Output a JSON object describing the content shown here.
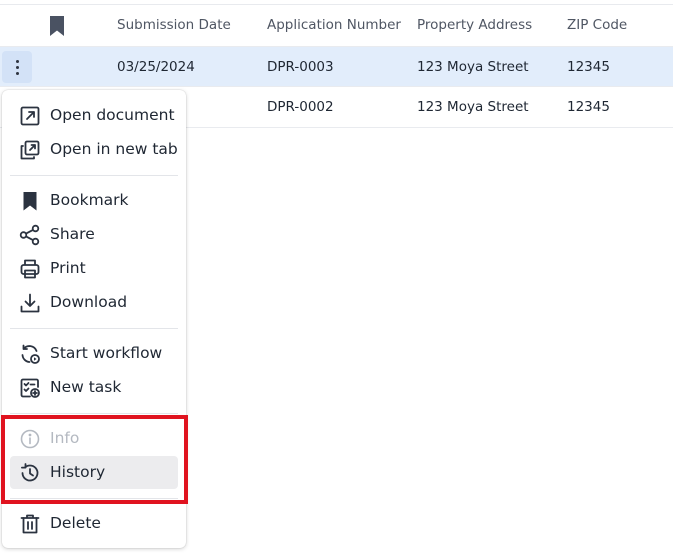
{
  "table": {
    "columns": {
      "submission_date": "Submission Date",
      "application_number": "Application Number",
      "property_address": "Property Address",
      "zip_code": "ZIP Code"
    },
    "rows": [
      {
        "submission_date": "03/25/2024",
        "application_number": "DPR-0003",
        "property_address": "123 Moya Street",
        "zip_code": "12345",
        "selected": true
      },
      {
        "submission_date": "",
        "application_number": "DPR-0002",
        "property_address": "123 Moya Street",
        "zip_code": "12345",
        "selected": false
      }
    ]
  },
  "context_menu": {
    "items": [
      {
        "label": "Open document",
        "icon": "open-external-icon"
      },
      {
        "label": "Open in new tab",
        "icon": "new-tab-icon"
      },
      {
        "label": "Bookmark",
        "icon": "bookmark-icon"
      },
      {
        "label": "Share",
        "icon": "share-icon"
      },
      {
        "label": "Print",
        "icon": "print-icon"
      },
      {
        "label": "Download",
        "icon": "download-icon"
      },
      {
        "label": "Start workflow",
        "icon": "workflow-icon"
      },
      {
        "label": "New task",
        "icon": "new-task-icon"
      },
      {
        "label": "Info",
        "icon": "info-icon",
        "disabled": true
      },
      {
        "label": "History",
        "icon": "history-icon",
        "hovered": true
      },
      {
        "label": "Delete",
        "icon": "trash-icon"
      }
    ]
  },
  "colors": {
    "selected_row": "#e2edfb",
    "highlight_border": "#e0131f",
    "hover_item": "#ececee"
  }
}
